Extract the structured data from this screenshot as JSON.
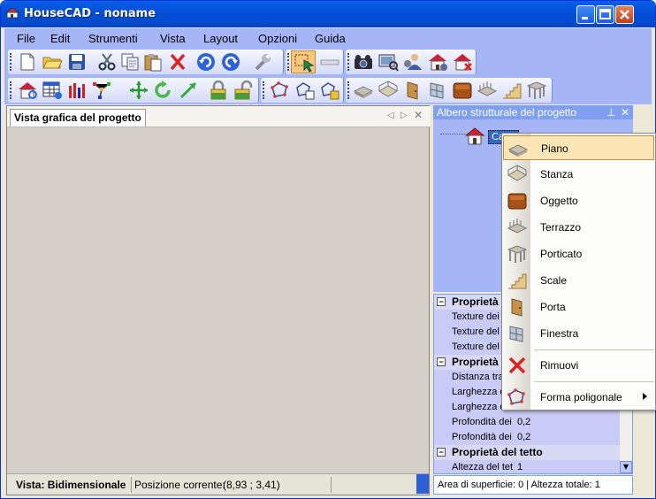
{
  "window": {
    "title": "HouseCAD - noname",
    "controls": [
      "minimize-icon",
      "maximize-icon",
      "close-icon"
    ]
  },
  "menu": [
    "File",
    "Edit",
    "Strumenti",
    "Vista",
    "Layout",
    "Opzioni",
    "Guida"
  ],
  "toolbar1": {
    "groups": [
      [
        "new-icon",
        "open-icon",
        "save-icon",
        "cut-icon",
        "copy-icon",
        "paste-icon",
        "delete-icon",
        "undo-icon",
        "redo-icon",
        "wrench-icon"
      ],
      [
        "select-icon",
        "measure-icon"
      ],
      [
        "camera-icon",
        "render-icon",
        "person-icon",
        "house-settings-icon",
        "house-remove-icon"
      ]
    ]
  },
  "toolbar2": {
    "groups": [
      [
        "house-refresh-icon",
        "table-icon",
        "chart-icon",
        "nodes-icon",
        "move-icon",
        "rotate-icon",
        "resize-icon",
        "lock-icon",
        "unlock-icon"
      ],
      [
        "polygon-icon",
        "polygon-copy-icon",
        "polygon-edit-icon"
      ],
      [
        "floor-icon",
        "room-icon",
        "door-icon",
        "window-icon",
        "object-icon",
        "terrace-icon",
        "stairs-icon",
        "porch-icon"
      ]
    ]
  },
  "document": {
    "tab_label": "Vista grafica del progetto",
    "status": {
      "view": "Vista: Bidimensionale",
      "position_label": "Posizione corrente:",
      "position_value": "(8,93 ; 3,41)"
    }
  },
  "tree": {
    "title": "Albero strutturale del progetto",
    "node_label": "Casa"
  },
  "properties": {
    "rows": [
      {
        "type": "cat",
        "label": "Proprietà d"
      },
      {
        "type": "item",
        "label": "Texture dei",
        "value": ""
      },
      {
        "type": "item",
        "label": "Texture del",
        "value": ""
      },
      {
        "type": "item",
        "label": "Texture del",
        "value": ""
      },
      {
        "type": "cat",
        "label": "Proprietà d"
      },
      {
        "type": "item",
        "label": "Distanza tra",
        "value": ""
      },
      {
        "type": "item",
        "label": "Larghezza d",
        "value": ""
      },
      {
        "type": "item",
        "label": "Larghezza d",
        "value": ""
      },
      {
        "type": "item",
        "label": "Profondità dei",
        "value": "0,2"
      },
      {
        "type": "item",
        "label": "Profondità dei",
        "value": "0,2"
      },
      {
        "type": "cat",
        "label": "Proprietà del tetto"
      },
      {
        "type": "item",
        "label": "Altezza del tet",
        "value": "1"
      }
    ]
  },
  "info": "Area di superficie: 0  |  Altezza totale: 1",
  "context_menu": {
    "items": [
      {
        "label": "Piano",
        "icon": "floor-icon",
        "selected": true
      },
      {
        "label": "Stanza",
        "icon": "room-icon"
      },
      {
        "label": "Oggetto",
        "icon": "object-icon"
      },
      {
        "label": "Terrazzo",
        "icon": "terrace-icon"
      },
      {
        "label": "Porticato",
        "icon": "porch-icon"
      },
      {
        "label": "Scale",
        "icon": "stairs-icon"
      },
      {
        "label": "Porta",
        "icon": "door-icon"
      },
      {
        "label": "Finestra",
        "icon": "window-icon"
      },
      {
        "label": "Rimuovi",
        "icon": "remove-icon"
      },
      {
        "label": "Forma poligonale",
        "icon": "polygon-icon",
        "submenu": true
      }
    ]
  }
}
